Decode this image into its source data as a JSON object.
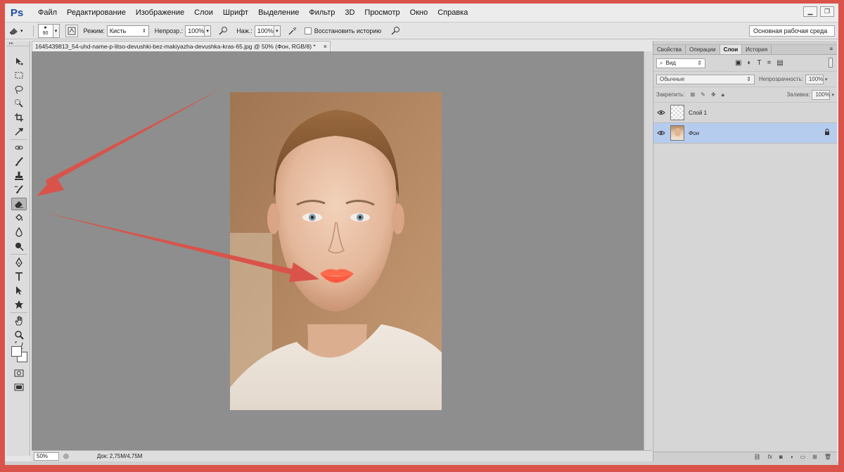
{
  "app": {
    "logo": "Ps"
  },
  "menu": [
    "Файл",
    "Редактирование",
    "Изображение",
    "Слои",
    "Шрифт",
    "Выделение",
    "Фильтр",
    "3D",
    "Просмотр",
    "Окно",
    "Справка"
  ],
  "window_controls": {
    "minimize": "▁",
    "restore": "❐"
  },
  "options": {
    "brush_size": "90",
    "mode_label": "Режим:",
    "mode_value": "Кисть",
    "opacity_label": "Непрозр.:",
    "opacity_value": "100%",
    "flow_label": "Наж.:",
    "flow_value": "100%",
    "restore_history_label": "Восстановить историю",
    "workspace": "Основная рабочая среда"
  },
  "document": {
    "tab_title": "1645439813_54-uhd-name-p-litso-devushki-bez-makiyazha-devushka-kras-65.jpg @ 50% (Фон, RGB/8) *",
    "close": "×",
    "zoom": "50%",
    "doc_size": "Док: 2,75M/4,75M"
  },
  "panels": {
    "tabs": [
      "Свойства",
      "Операции",
      "Слои",
      "История"
    ],
    "active_tab": "Слои",
    "kind_filter": "Вид",
    "blend_mode": "Обычные",
    "opacity_label": "Непрозрачность:",
    "opacity_value": "100%",
    "lock_label": "Закрепить:",
    "fill_label": "Заливка:",
    "fill_value": "100%",
    "layers": [
      {
        "name": "Слой 1",
        "selected": false,
        "locked": false
      },
      {
        "name": "Фон",
        "selected": true,
        "locked": true
      }
    ]
  },
  "colors": {
    "arrow": "#d9534a",
    "selection": "#b6ccef",
    "canvas_bg": "#8e8e8e"
  }
}
